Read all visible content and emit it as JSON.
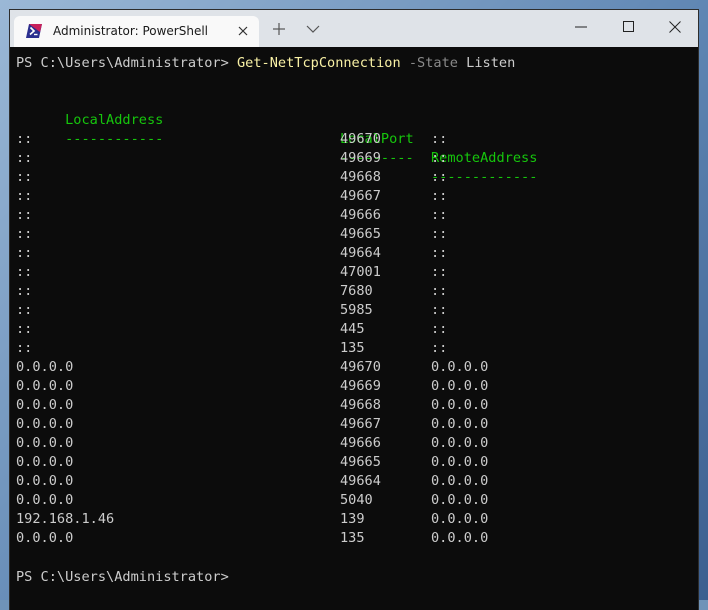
{
  "window": {
    "tab_title": "Administrator: PowerShell"
  },
  "terminal": {
    "prompt": "PS C:\\Users\\Administrator> ",
    "command": "Get-NetTcpConnection",
    "param_name": "-State",
    "param_value": "Listen",
    "headers": [
      "LocalAddress",
      "LocalPort",
      "RemoteAddress"
    ],
    "underlines": [
      "------------",
      "---------",
      "-------------"
    ],
    "rows": [
      {
        "local_address": "::",
        "local_port": "49670",
        "remote_address": "::"
      },
      {
        "local_address": "::",
        "local_port": "49669",
        "remote_address": "::"
      },
      {
        "local_address": "::",
        "local_port": "49668",
        "remote_address": "::"
      },
      {
        "local_address": "::",
        "local_port": "49667",
        "remote_address": "::"
      },
      {
        "local_address": "::",
        "local_port": "49666",
        "remote_address": "::"
      },
      {
        "local_address": "::",
        "local_port": "49665",
        "remote_address": "::"
      },
      {
        "local_address": "::",
        "local_port": "49664",
        "remote_address": "::"
      },
      {
        "local_address": "::",
        "local_port": "47001",
        "remote_address": "::"
      },
      {
        "local_address": "::",
        "local_port": "7680",
        "remote_address": "::"
      },
      {
        "local_address": "::",
        "local_port": "5985",
        "remote_address": "::"
      },
      {
        "local_address": "::",
        "local_port": "445",
        "remote_address": "::"
      },
      {
        "local_address": "::",
        "local_port": "135",
        "remote_address": "::"
      },
      {
        "local_address": "0.0.0.0",
        "local_port": "49670",
        "remote_address": "0.0.0.0"
      },
      {
        "local_address": "0.0.0.0",
        "local_port": "49669",
        "remote_address": "0.0.0.0"
      },
      {
        "local_address": "0.0.0.0",
        "local_port": "49668",
        "remote_address": "0.0.0.0"
      },
      {
        "local_address": "0.0.0.0",
        "local_port": "49667",
        "remote_address": "0.0.0.0"
      },
      {
        "local_address": "0.0.0.0",
        "local_port": "49666",
        "remote_address": "0.0.0.0"
      },
      {
        "local_address": "0.0.0.0",
        "local_port": "49665",
        "remote_address": "0.0.0.0"
      },
      {
        "local_address": "0.0.0.0",
        "local_port": "49664",
        "remote_address": "0.0.0.0"
      },
      {
        "local_address": "0.0.0.0",
        "local_port": "5040",
        "remote_address": "0.0.0.0"
      },
      {
        "local_address": "192.168.1.46",
        "local_port": "139",
        "remote_address": "0.0.0.0"
      },
      {
        "local_address": "0.0.0.0",
        "local_port": "135",
        "remote_address": "0.0.0.0"
      }
    ],
    "final_prompt": "PS C:\\Users\\Administrator>"
  },
  "colors": {
    "command": "#f9f1a5",
    "parameter": "#8a8a8a",
    "header": "#16c60c",
    "text": "#cccccc",
    "background": "#0c0c0c"
  },
  "icons": {
    "tab": "powershell-icon",
    "close_tab": "close-icon",
    "new_tab": "plus-icon",
    "dropdown": "chevron-down-icon",
    "minimize": "minimize-icon",
    "maximize": "maximize-icon",
    "close_window": "close-window-icon"
  }
}
